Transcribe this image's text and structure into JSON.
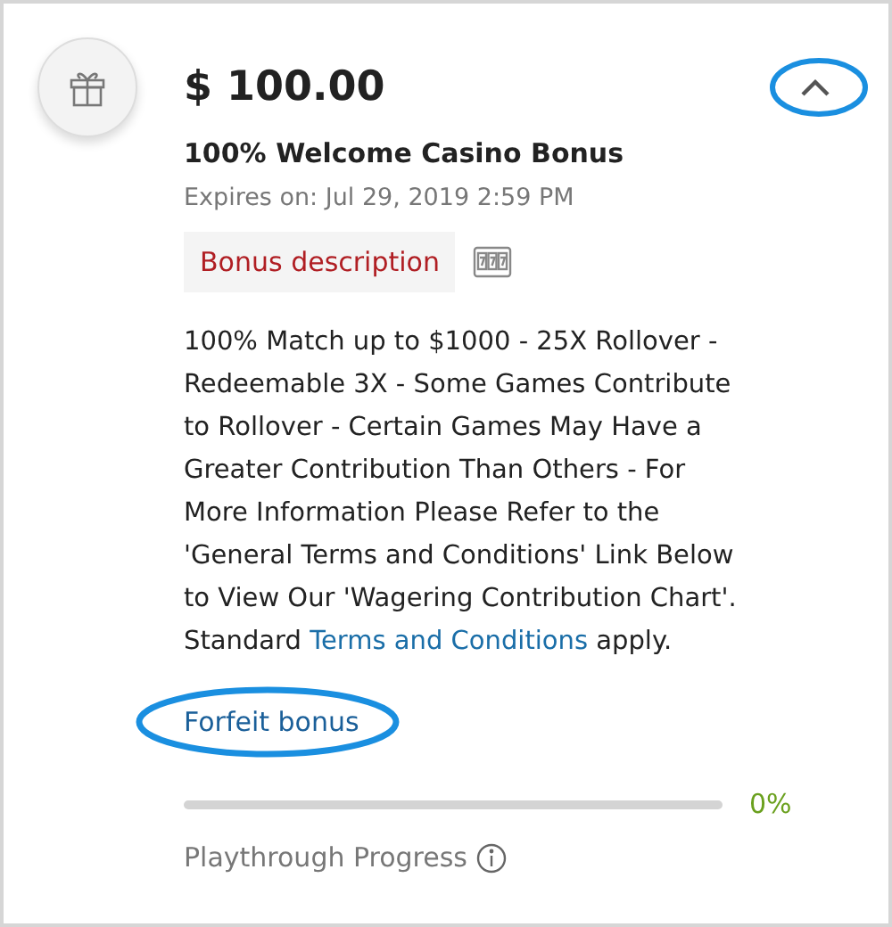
{
  "bonus": {
    "amount": "$ 100.00",
    "expanded": true,
    "title": "100% Welcome Casino Bonus",
    "expires": "Expires on: Jul 29, 2019 2:59 PM"
  },
  "tabs": [
    {
      "kind": "text",
      "label": "Bonus description",
      "selected": true
    },
    {
      "kind": "slots",
      "selected": false
    }
  ],
  "description": {
    "text": "100% Match up to $1000 - 25X Rollover - Redeemable 3X - Some Games Contribute to Rollover - Certain Games May Have a Greater Contribution Than Others - For More Information Please Refer to the 'General Terms and Conditions' Link Below to View Our 'Wagering Contribution Chart'. Standard",
    "link": "Terms and Conditions",
    "after": "apply."
  },
  "forfeit_link": "Forfeit bonus",
  "progress": {
    "level": 0,
    "reading": "0%",
    "label": "Playthrough Progress"
  }
}
